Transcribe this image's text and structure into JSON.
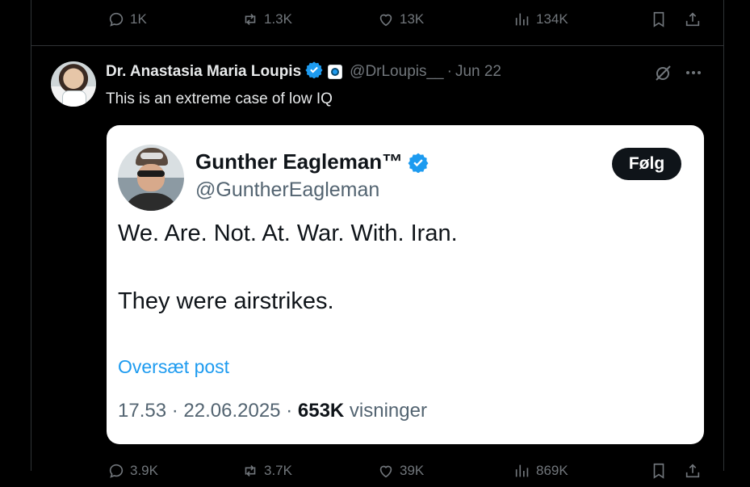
{
  "top_actions": {
    "replies": "1K",
    "reposts": "1.3K",
    "likes": "13K",
    "views": "134K"
  },
  "tweet": {
    "author_name": "Dr. Anastasia Maria Loupis",
    "handle": "@DrLoupis__",
    "separator": "·",
    "date": "Jun 22",
    "text": "This is an extreme case of low IQ"
  },
  "quoted": {
    "author_name": "Gunther Eagleman™",
    "handle": "@GuntherEagleman",
    "follow_label": "Følg",
    "line1": "We. Are. Not. At. War. With. Iran.",
    "line2": "They were airstrikes.",
    "translate_label": "Oversæt post",
    "time": "17.53",
    "date": "22.06.2025",
    "sep": "·",
    "views_count": "653K",
    "views_label": "visninger"
  },
  "bottom_actions": {
    "replies": "3.9K",
    "reposts": "3.7K",
    "likes": "39K",
    "views": "869K"
  },
  "colors": {
    "background": "#000000",
    "text": "#e7e9ea",
    "muted": "#71767b",
    "accent": "#1d9bf0",
    "card_bg": "#ffffff"
  }
}
